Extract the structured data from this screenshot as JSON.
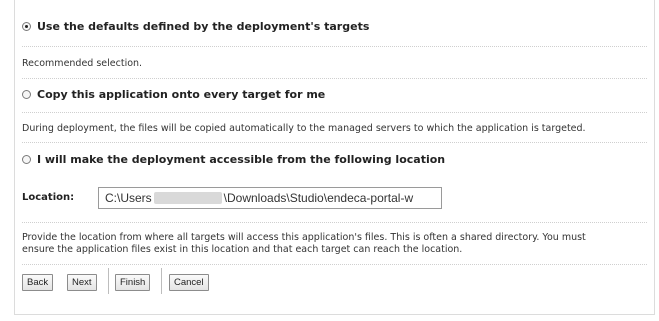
{
  "options": {
    "defaults": {
      "label": "Use the defaults defined by the deployment's targets",
      "selected": true
    },
    "defaults_desc": "Recommended selection.",
    "copy": {
      "label": "Copy this application onto every target for me",
      "selected": false
    },
    "copy_desc": "During deployment, the files will be copied automatically to the managed servers to which the application is targeted.",
    "accessible": {
      "label": "I will make the deployment accessible from the following location",
      "selected": false
    }
  },
  "location": {
    "label": "Location:",
    "value_prefix": "C:\\Users",
    "value_suffix": "\\Downloads\\Studio\\endeca-portal-w"
  },
  "location_desc_line1": "Provide the location from where all targets will access this application's files. This is often a shared directory. You must",
  "location_desc_line2": "ensure the application files exist in this location and that each target can reach the location.",
  "buttons": {
    "back": "Back",
    "next": "Next",
    "finish": "Finish",
    "cancel": "Cancel"
  }
}
